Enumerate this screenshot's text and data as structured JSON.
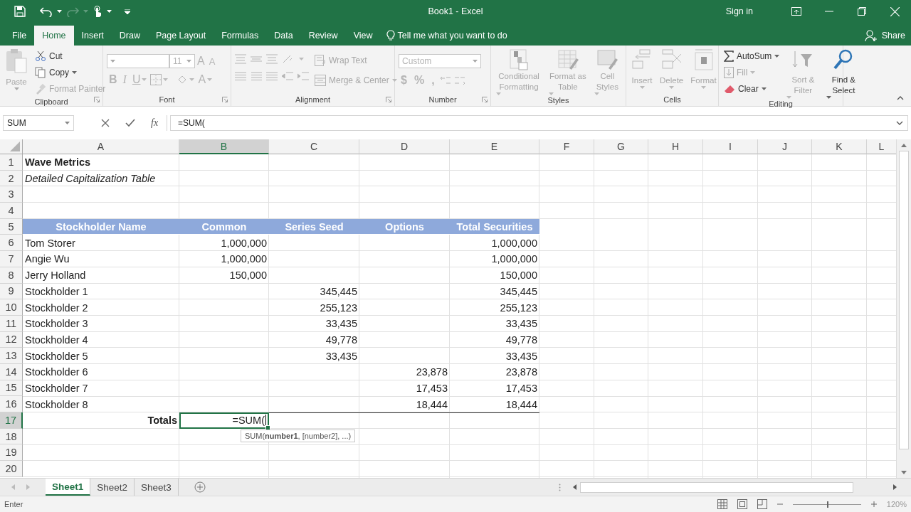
{
  "title_bar": {
    "title": "Book1  -  Excel",
    "sign_in": "Sign in",
    "redo_disabled": true
  },
  "tabs": [
    {
      "label": "File",
      "selected": false
    },
    {
      "label": "Home",
      "selected": true
    },
    {
      "label": "Insert",
      "selected": false
    },
    {
      "label": "Draw",
      "selected": false
    },
    {
      "label": "Page Layout",
      "selected": false
    },
    {
      "label": "Formulas",
      "selected": false
    },
    {
      "label": "Data",
      "selected": false
    },
    {
      "label": "Review",
      "selected": false
    },
    {
      "label": "View",
      "selected": false
    }
  ],
  "tell_me": "Tell me what you want to do",
  "share": "Share",
  "ribbon": {
    "groups": [
      {
        "kind": "clipboard",
        "label": "Clipboard",
        "buttons": [
          {
            "label": "Paste",
            "disabled": true
          },
          {
            "label": "Cut",
            "disabled": false
          },
          {
            "label": "Copy",
            "disabled": false
          },
          {
            "label": "Format Painter",
            "disabled": true
          }
        ]
      },
      {
        "kind": "font",
        "label": "Font",
        "disabled": true,
        "size": "11",
        "letters": [
          "A",
          "A",
          "B",
          "I",
          "U",
          "A"
        ]
      },
      {
        "kind": "alignment",
        "label": "Alignment",
        "disabled": true,
        "buttons": [
          {
            "label": "Wrap Text"
          },
          {
            "label": "Merge & Center"
          }
        ]
      },
      {
        "kind": "number",
        "label": "Number",
        "disabled": true,
        "format": "Custom",
        "symbols": [
          "$",
          "%",
          ","
        ]
      },
      {
        "kind": "styles",
        "label": "Styles",
        "disabled": true,
        "buttons": [
          {
            "label": "Conditional Formatting"
          },
          {
            "label": "Format as Table"
          },
          {
            "label": "Cell Styles"
          }
        ]
      },
      {
        "kind": "cells",
        "label": "Cells",
        "disabled": true,
        "buttons": [
          {
            "label": "Insert"
          },
          {
            "label": "Delete"
          },
          {
            "label": "Format"
          }
        ]
      },
      {
        "kind": "editing",
        "label": "Editing",
        "buttons": [
          {
            "label": "AutoSum",
            "disabled": false
          },
          {
            "label": "Fill",
            "disabled": true
          },
          {
            "label": "Clear",
            "disabled": false
          },
          {
            "label": "Sort & Filter",
            "disabled": true
          },
          {
            "label": "Find & Select",
            "disabled": false
          }
        ]
      }
    ]
  },
  "formula_bar": {
    "name_box": "SUM",
    "function_button": "fx",
    "formula": "=SUM("
  },
  "grid": {
    "columns": [
      {
        "label": "A",
        "selected": false
      },
      {
        "label": "B",
        "selected": true
      },
      {
        "label": "C",
        "selected": false
      },
      {
        "label": "D",
        "selected": false
      },
      {
        "label": "E",
        "selected": false
      },
      {
        "label": "F",
        "selected": false
      },
      {
        "label": "G",
        "selected": false
      },
      {
        "label": "H",
        "selected": false
      },
      {
        "label": "I",
        "selected": false
      },
      {
        "label": "J",
        "selected": false
      },
      {
        "label": "K",
        "selected": false
      },
      {
        "label": "L",
        "selected": false
      }
    ],
    "rows": [
      {
        "number": "1",
        "kind": "title",
        "selected": false,
        "cells": {
          "a": "Wave Metrics"
        }
      },
      {
        "number": "2",
        "kind": "subtitle",
        "selected": false,
        "cells": {
          "a": "Detailed Capitalization Table"
        }
      },
      {
        "number": "3",
        "kind": "blank",
        "selected": false
      },
      {
        "number": "4",
        "kind": "blank",
        "selected": false
      },
      {
        "number": "5",
        "kind": "header",
        "selected": false,
        "cells": {
          "a": "Stockholder Name",
          "b": "Common",
          "c": "Series Seed",
          "d": "Options",
          "e": "Total Securities"
        }
      },
      {
        "number": "6",
        "kind": "data",
        "selected": false,
        "cells": {
          "a": "Tom Storer",
          "b": "1,000,000",
          "e": "1,000,000"
        }
      },
      {
        "number": "7",
        "kind": "data",
        "selected": false,
        "cells": {
          "a": "Angie Wu",
          "b": "1,000,000",
          "e": "1,000,000"
        }
      },
      {
        "number": "8",
        "kind": "data",
        "selected": false,
        "cells": {
          "a": "Jerry Holland",
          "b": "150,000",
          "e": "150,000"
        }
      },
      {
        "number": "9",
        "kind": "data",
        "selected": false,
        "cells": {
          "a": "Stockholder 1",
          "c": "345,445",
          "e": "345,445"
        }
      },
      {
        "number": "10",
        "kind": "data",
        "selected": false,
        "cells": {
          "a": "Stockholder 2",
          "c": "255,123",
          "e": "255,123"
        }
      },
      {
        "number": "11",
        "kind": "data",
        "selected": false,
        "cells": {
          "a": "Stockholder 3",
          "c": "33,435",
          "e": "33,435"
        }
      },
      {
        "number": "12",
        "kind": "data",
        "selected": false,
        "cells": {
          "a": "Stockholder 4",
          "c": "49,778",
          "e": "49,778"
        }
      },
      {
        "number": "13",
        "kind": "data",
        "selected": false,
        "cells": {
          "a": "Stockholder 5",
          "c": "33,435",
          "e": "33,435"
        }
      },
      {
        "number": "14",
        "kind": "data",
        "selected": false,
        "cells": {
          "a": "Stockholder 6",
          "d": "23,878",
          "e": "23,878"
        }
      },
      {
        "number": "15",
        "kind": "data",
        "selected": false,
        "cells": {
          "a": "Stockholder 7",
          "d": "17,453",
          "e": "17,453"
        }
      },
      {
        "number": "16",
        "kind": "data",
        "selected": false,
        "cells": {
          "a": "Stockholder 8",
          "d": "18,444",
          "e": "18,444"
        }
      },
      {
        "number": "17",
        "kind": "total",
        "selected": true,
        "cells": {
          "a": "Totals"
        }
      },
      {
        "number": "18",
        "kind": "blank",
        "selected": false
      },
      {
        "number": "19",
        "kind": "blank",
        "selected": false
      },
      {
        "number": "20",
        "kind": "blank",
        "selected": false
      }
    ],
    "editing": {
      "text": "=SUM(",
      "tooltip": "SUM(**number1**, [number2], ...)"
    }
  },
  "sheet_tabs": [
    {
      "label": "Sheet1",
      "selected": true
    },
    {
      "label": "Sheet2",
      "selected": false
    },
    {
      "label": "Sheet3",
      "selected": false
    }
  ],
  "status_bar": {
    "mode": "Enter",
    "zoom": "120%",
    "level": 0.5
  }
}
